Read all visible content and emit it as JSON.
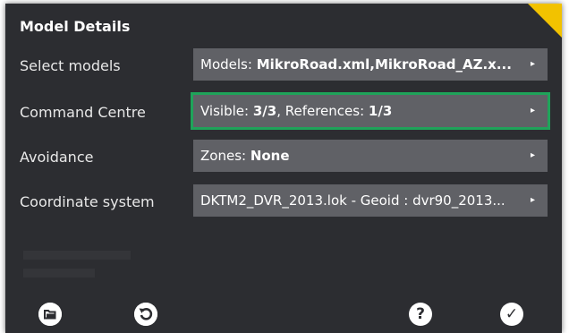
{
  "dialog": {
    "title": "Model Details"
  },
  "rows": [
    {
      "label": "Select models",
      "prefix": "Models: ",
      "bold": "MikroRoad.xml,MikroRoad_AZ.x...",
      "suffix": ""
    },
    {
      "label": "Command Centre",
      "prefix": "Visible: ",
      "bold": "3/3",
      "suffix": ", References: ",
      "bold2": "1/3"
    },
    {
      "label": "Avoidance",
      "prefix": "Zones: ",
      "bold": "None",
      "suffix": ""
    },
    {
      "label": "Coordinate system",
      "prefix": "DKTM2_DVR_2013.lok - Geoid : dvr90_2013...",
      "bold": "",
      "suffix": ""
    }
  ],
  "icons": {
    "field_arrow": "▸",
    "help": "?",
    "ok": "✓",
    "undo": "↺",
    "folder": "folder-icon"
  },
  "colors": {
    "accent": "#f2c200",
    "selected_outline": "#1fa35a",
    "panel_bg": "#2c2d31",
    "field_bg": "#606166"
  }
}
